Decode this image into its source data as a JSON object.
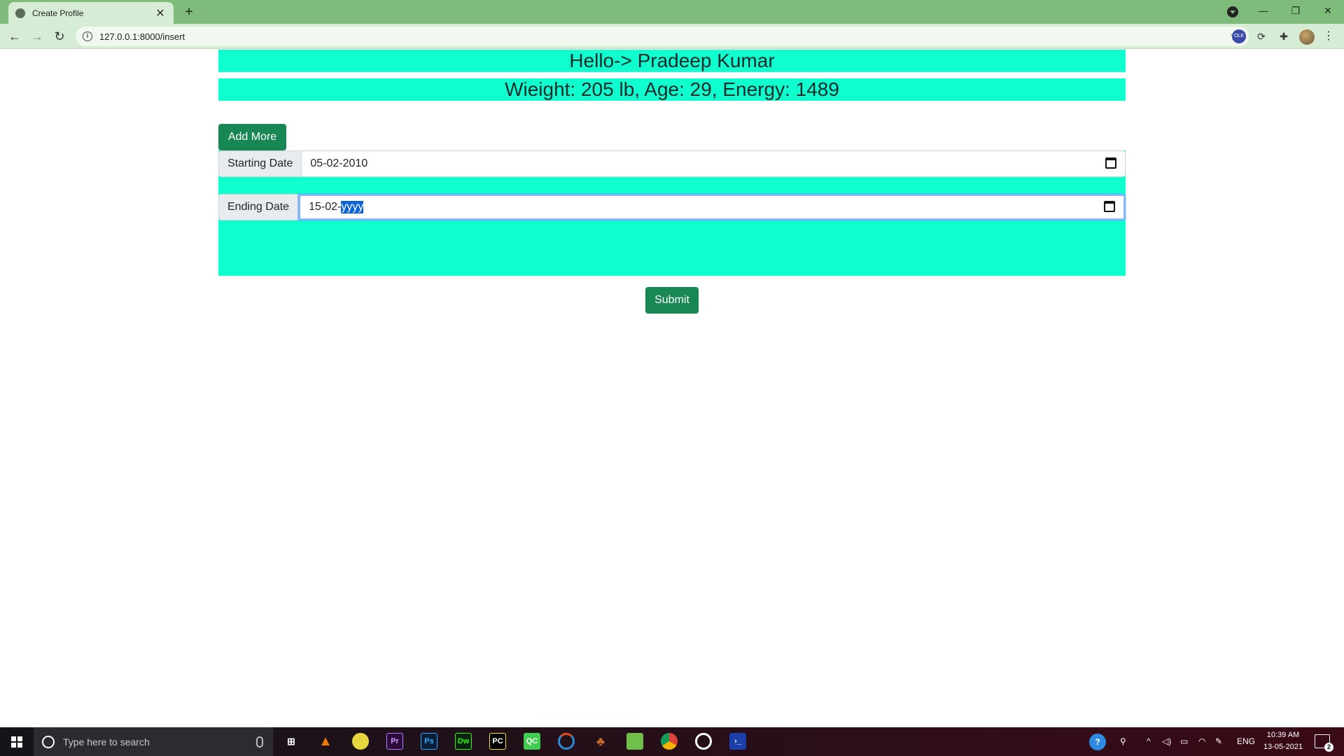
{
  "browser": {
    "tab_title": "Create Profile",
    "tab_close": "✕",
    "new_tab": "+",
    "url": "127.0.0.1:8000/insert",
    "win_min": "—",
    "win_restore": "❐",
    "win_close": "✕"
  },
  "header": {
    "greeting": "Hello-> Pradeep Kumar",
    "stats": "Wieight: 205 lb, Age: 29, Energy: 1489"
  },
  "form": {
    "add_more_label": "Add More",
    "start_label": "Starting Date",
    "start_value": "05-02-2010",
    "end_label": "Ending Date",
    "end_value_prefix": "15-02-",
    "end_value_selected": "yyyy",
    "submit_label": "Submit"
  },
  "taskbar": {
    "search_placeholder": "Type here to search",
    "lang": "ENG",
    "time": "10:39 AM",
    "date": "13-05-2021",
    "notif_count": "2",
    "apps": [
      "task-view",
      "vlc",
      "app-yellow",
      "premiere",
      "photoshop",
      "dreamweaver",
      "pycharm",
      "qt-creator",
      "app-circle",
      "app-fruit",
      "notepad",
      "chrome",
      "obs",
      "powershell"
    ]
  },
  "colors": {
    "tab_bar": "#7fbb7a",
    "banner": "#10ffcf",
    "button": "#198754",
    "selection": "#0a64d6"
  }
}
